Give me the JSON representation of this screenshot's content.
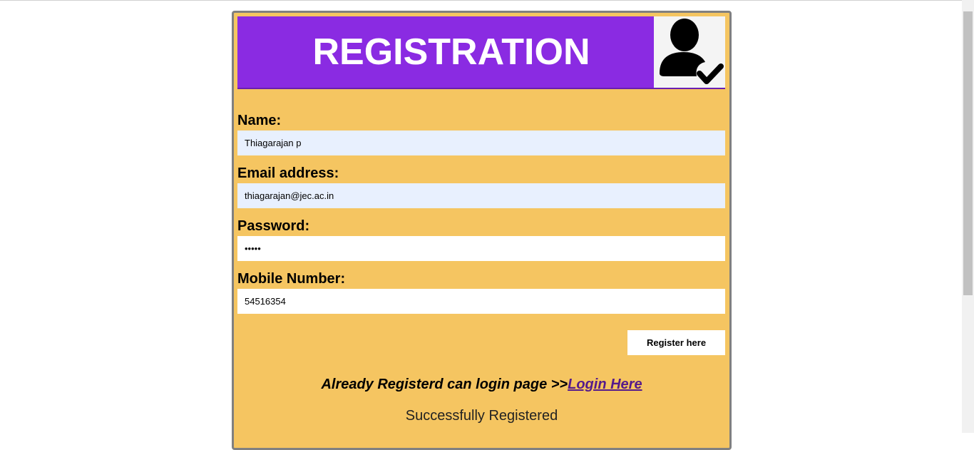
{
  "header": {
    "title": "REGISTRATION",
    "icon": "user-check-icon"
  },
  "form": {
    "name": {
      "label": "Name:",
      "value": "Thiagarajan p"
    },
    "email": {
      "label": "Email address:",
      "value": "thiagarajan@jec.ac.in"
    },
    "password": {
      "label": "Password:",
      "value": "•••••"
    },
    "mobile": {
      "label": "Mobile Number:",
      "value": "54516354"
    },
    "submit_label": "Register here"
  },
  "footer": {
    "login_prompt": "Already Registerd can login page >>",
    "login_link": "Login Here",
    "status": "Successfully Registered"
  },
  "colors": {
    "card_bg": "#f5c561",
    "header_bg": "#8a2be2",
    "autofill_bg": "#e8f0fe",
    "link": "#551a8b"
  }
}
